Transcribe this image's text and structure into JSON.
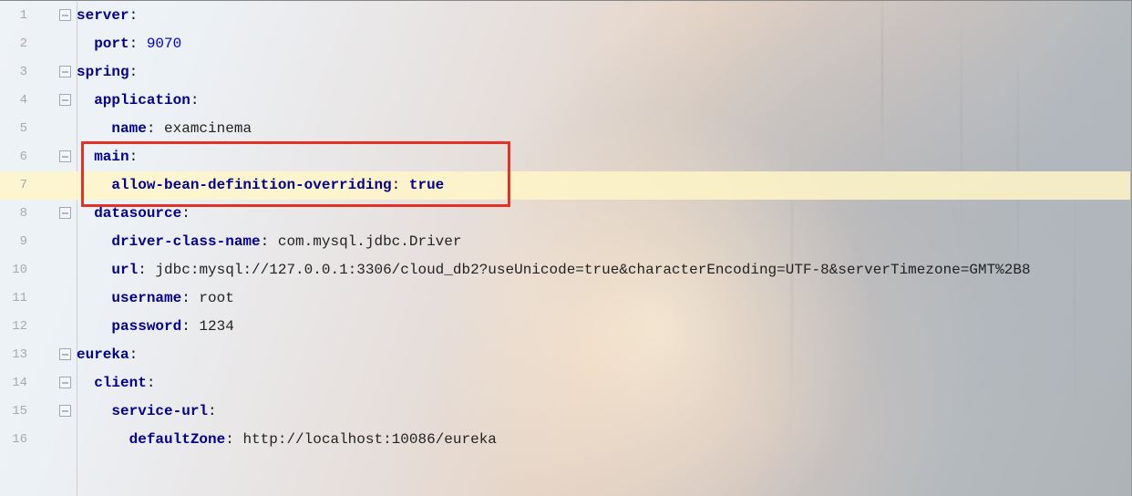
{
  "lines": [
    {
      "num": "1",
      "fold": true,
      "indent": 0,
      "key": "server",
      "colon": ":",
      "value": "",
      "vclass": ""
    },
    {
      "num": "2",
      "fold": false,
      "indent": 1,
      "key": "port",
      "colon": ":",
      "value": " 9070",
      "vclass": "tok-num"
    },
    {
      "num": "3",
      "fold": true,
      "indent": 0,
      "key": "spring",
      "colon": ":",
      "value": "",
      "vclass": ""
    },
    {
      "num": "4",
      "fold": true,
      "indent": 1,
      "key": "application",
      "colon": ":",
      "value": "",
      "vclass": ""
    },
    {
      "num": "5",
      "fold": false,
      "indent": 2,
      "key": "name",
      "colon": ":",
      "value": " examcinema",
      "vclass": "tok-str"
    },
    {
      "num": "6",
      "fold": true,
      "indent": 1,
      "key": "main",
      "colon": ":",
      "value": "",
      "vclass": ""
    },
    {
      "num": "7",
      "fold": false,
      "indent": 2,
      "key": "allow-bean-definition-overriding",
      "colon": ":",
      "value": " true",
      "vclass": "tok-bool"
    },
    {
      "num": "8",
      "fold": true,
      "indent": 1,
      "key": "datasource",
      "colon": ":",
      "value": "",
      "vclass": ""
    },
    {
      "num": "9",
      "fold": false,
      "indent": 2,
      "key": "driver-class-name",
      "colon": ":",
      "value": " com.mysql.jdbc.Driver",
      "vclass": "tok-str"
    },
    {
      "num": "10",
      "fold": false,
      "indent": 2,
      "key": "url",
      "colon": ":",
      "value": " jdbc:mysql://127.0.0.1:3306/cloud_db2?useUnicode=true&characterEncoding=UTF-8&serverTimezone=GMT%2B8",
      "vclass": "tok-str"
    },
    {
      "num": "11",
      "fold": false,
      "indent": 2,
      "key": "username",
      "colon": ":",
      "value": " root",
      "vclass": "tok-str"
    },
    {
      "num": "12",
      "fold": false,
      "indent": 2,
      "key": "password",
      "colon": ":",
      "value": " 1234",
      "vclass": "tok-str"
    },
    {
      "num": "13",
      "fold": true,
      "indent": 0,
      "key": "eureka",
      "colon": ":",
      "value": "",
      "vclass": ""
    },
    {
      "num": "14",
      "fold": true,
      "indent": 1,
      "key": "client",
      "colon": ":",
      "value": "",
      "vclass": ""
    },
    {
      "num": "15",
      "fold": true,
      "indent": 2,
      "key": "service-url",
      "colon": ":",
      "value": "",
      "vclass": ""
    },
    {
      "num": "16",
      "fold": false,
      "indent": 3,
      "key": "defaultZone",
      "colon": ":",
      "value": " http://localhost:10086/eureka",
      "vclass": "tok-str"
    }
  ],
  "highlightLineIndex": 6,
  "redBox": {
    "startLineIndex": 5,
    "lineSpan": 2
  }
}
